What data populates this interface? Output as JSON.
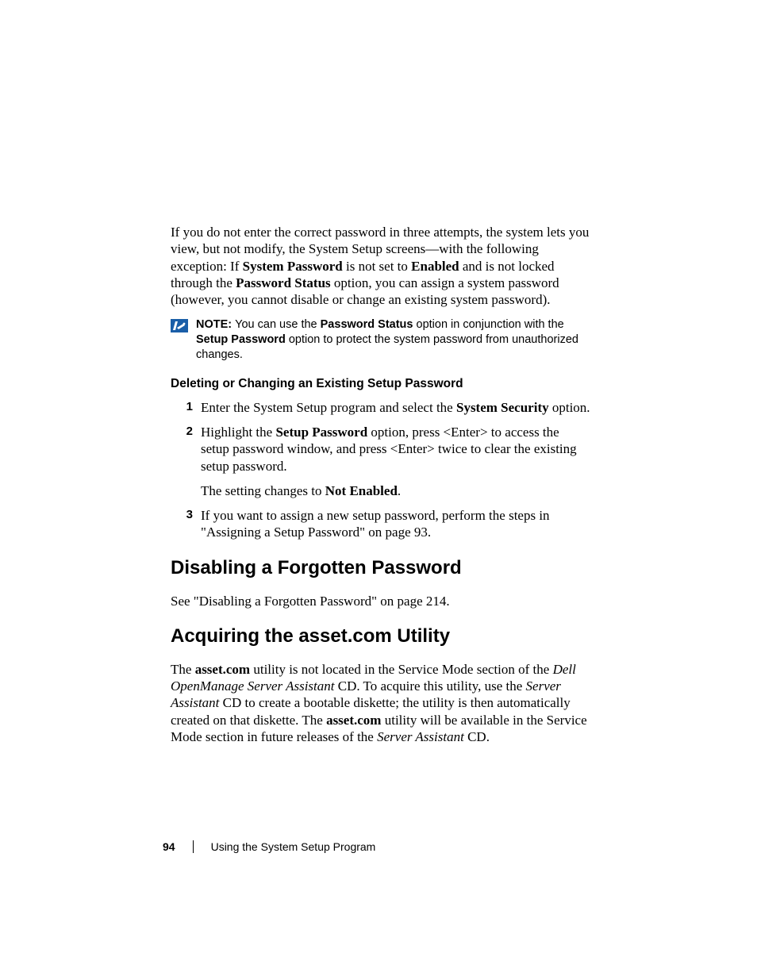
{
  "intro": {
    "pre": "If you do not enter the correct password in three attempts, the system lets you view, but not modify, the System Setup screens—with the following exception: If ",
    "b1": "System Password",
    "mid1": " is not set to ",
    "b2": "Enabled",
    "mid2": " and is not locked through the ",
    "b3": "Password Status",
    "post": " option, you can assign a system password (however, you cannot disable or change an existing system password)."
  },
  "note": {
    "label": "NOTE: ",
    "pre": "You can use the ",
    "b1": "Password Status",
    "mid1": " option in conjunction with the ",
    "b2": "Setup Password",
    "post": " option to protect the system password from unauthorized changes."
  },
  "h3": "Deleting or Changing an Existing Setup Password",
  "steps": {
    "s1": {
      "num": "1",
      "pre": "Enter the System Setup program and select the ",
      "b1": "System Security",
      "post": " option."
    },
    "s2": {
      "num": "2",
      "pre": "Highlight the ",
      "b1": "Setup Password",
      "post": " option, press <Enter> to access the setup password window, and press <Enter> twice to clear the existing setup password.",
      "sub_pre": "The setting changes to ",
      "sub_b": "Not Enabled",
      "sub_post": "."
    },
    "s3": {
      "num": "3",
      "text": "If you want to assign a new setup password, perform the steps in \"Assigning a Setup Password\" on page 93."
    }
  },
  "h2a": "Disabling a Forgotten Password",
  "p2a": "See \"Disabling a Forgotten Password\" on page 214.",
  "h2b": "Acquiring the asset.com Utility",
  "p2b": {
    "pre": "The ",
    "b1": "asset.com",
    "mid1": " utility is not located in the Service Mode section of the ",
    "i1": "Dell OpenManage Server Assistant",
    "mid2": " CD. To acquire this utility, use the ",
    "i2": "Server Assistant",
    "mid3": " CD to create a bootable diskette; the utility is then automatically created on that diskette. The ",
    "b2": "asset.com",
    "mid4": " utility will be available in the Service Mode section in future releases of the ",
    "i3": "Server Assistant",
    "post": " CD."
  },
  "footer": {
    "page": "94",
    "title": "Using the System Setup Program"
  }
}
